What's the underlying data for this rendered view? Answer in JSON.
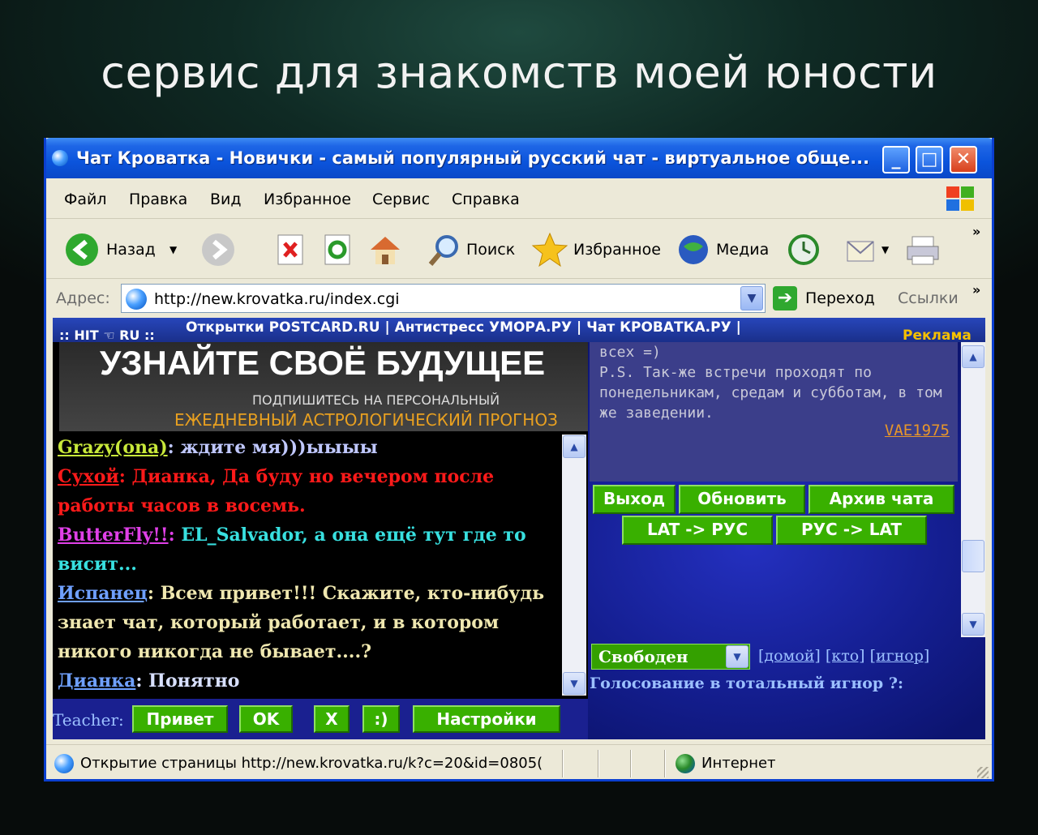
{
  "headline": "сервис для знакомств моей юности",
  "window": {
    "title": "Чат Кроватка - Новички - самый популярный русский чат - виртуальное обще...",
    "min_glyph": "_",
    "max_glyph": "□",
    "close_glyph": "✕"
  },
  "menu": {
    "items": [
      "Файл",
      "Правка",
      "Вид",
      "Избранное",
      "Сервис",
      "Справка"
    ]
  },
  "toolbar": {
    "back": "Назад",
    "search": "Поиск",
    "favorites": "Избранное",
    "media": "Медиа",
    "more": "»"
  },
  "address": {
    "label": "Адрес:",
    "url": "http://new.krovatka.ru/index.cgi",
    "go": "Переход",
    "links": "Ссылки",
    "more": "»"
  },
  "page": {
    "topbar": {
      "left": ":: HIT ☜ RU ::",
      "links": "Открытки POSTCARD.RU | Антистресс УМОРА.РУ | Чат КРОВАТКА.РУ |",
      "ad": "Реклама"
    },
    "banner": {
      "title": "УЗНАЙТЕ СВОЁ БУДУЩЕЕ",
      "subtitle": "ПОДПИШИТЕСЬ НА ПЕРСОНАЛЬНЫЙ",
      "astro": "ЕЖЕДНЕВНЫЙ АСТРОЛОГИЧЕСКИЙ ПРОГНОЗ"
    },
    "chat": [
      {
        "nick": "Grazy(ona)",
        "text": "ждите мя)))ыыыы",
        "color": "#c8e83a",
        "text_color": "#c0c8ff"
      },
      {
        "nick": "Сухой",
        "text": "Дианка, Да буду но вечером после работы часов в восемь.",
        "color": "#ff1a1a",
        "text_color": "#ff1a1a"
      },
      {
        "nick": "ButterFly!!",
        "text": "EL_Salvador, а она ещё тут где то висит...",
        "color": "#e040e8",
        "text_color": "#38e0e0"
      },
      {
        "nick": "Испанец",
        "text": "Всем привет!!! Скажите, кто-нибудь знает чат, который работает, и в котором никого никогда не бывает....?",
        "color": "#6fa0ff",
        "text_color": "#f0e8b0"
      },
      {
        "nick": "Дианка",
        "text": "Понятно",
        "color": "#6fa0ff",
        "text_color": "#d8e0ff"
      }
    ],
    "bottom": {
      "teacher_label": "Teacher:",
      "buttons": [
        "Привет",
        "OK",
        "X",
        ":)",
        "Настройки"
      ]
    },
    "message": {
      "text": "всех =)\nP.S. Так-же встречи проходят по понедельникам, средам и субботам, в том же заведении.",
      "author": "VAE1975"
    },
    "right_buttons": {
      "row1": [
        "Выход",
        "Обновить",
        "Архив чата"
      ],
      "row2": [
        "LAT -> РУС",
        "РУС -> LAT"
      ]
    },
    "status": {
      "selected": "Свободен",
      "links": [
        "[домой]",
        "[кто]",
        "[игнор]"
      ],
      "vote": "Голосование в тотальный игнор ?:"
    }
  },
  "statusbar": {
    "text": "Открытие страницы http://new.krovatka.ru/k?c=20&id=0805(",
    "zone": "Интернет"
  }
}
